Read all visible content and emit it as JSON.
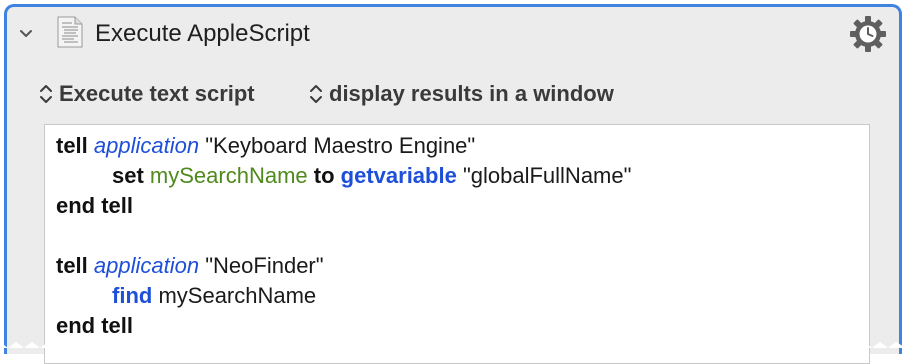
{
  "action": {
    "title": "Execute AppleScript",
    "script_source_option": "Execute text script",
    "results_option": "display results in a window",
    "icons": {
      "disclosure": "chevron-down-icon",
      "action_type": "script-document-icon",
      "settings": "gear-clock-icon",
      "popup": "up-down-chevron-icon"
    }
  },
  "script": {
    "line1": {
      "kw_tell": "tell",
      "app_kw": "application",
      "app_name": "\"Keyboard Maestro Engine\""
    },
    "line2": {
      "kw_set": "set",
      "var": "mySearchName",
      "kw_to": "to",
      "cmd": "getvariable",
      "arg": "\"globalFullName\""
    },
    "line3": {
      "kw_end": "end tell"
    },
    "line5": {
      "kw_tell": "tell",
      "app_kw": "application",
      "app_name": "\"NeoFinder\""
    },
    "line6": {
      "cmd": "find",
      "arg": "mySearchName"
    },
    "line7": {
      "kw_end": "end tell"
    }
  },
  "colors": {
    "selection_border": "#3f82e0",
    "keyword_blue": "#1d4fd9",
    "variable_green": "#4f8a1c"
  }
}
